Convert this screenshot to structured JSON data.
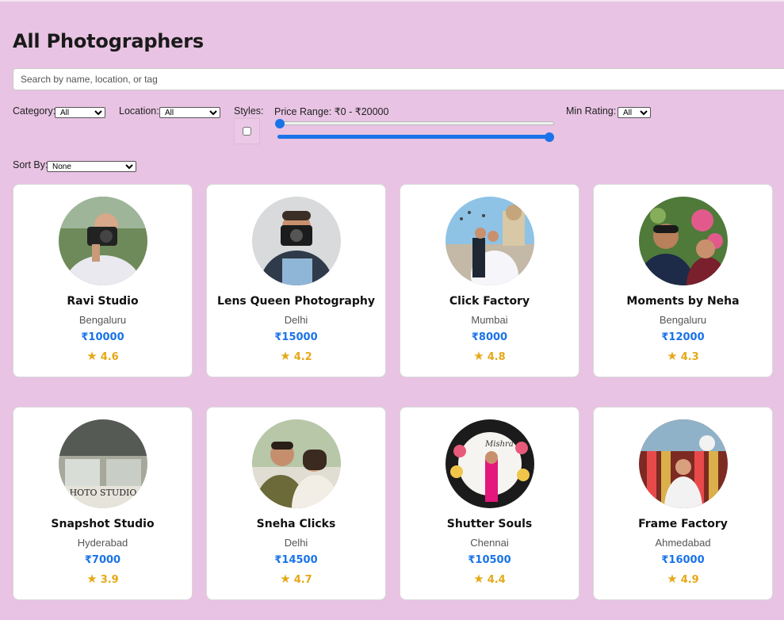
{
  "page": {
    "title": "All Photographers"
  },
  "search": {
    "placeholder": "Search by name, location, or tag",
    "value": ""
  },
  "filters": {
    "category_label": "Category:",
    "category_value": "All",
    "location_label": "Location:",
    "location_value": "All",
    "styles_label": "Styles:",
    "price_label": "Price Range: ₹0 - ₹20000",
    "price_min": 0,
    "price_max": 20000,
    "rating_label": "Min Rating:",
    "rating_value": "All",
    "sort_label": "Sort By:",
    "sort_value": "None"
  },
  "colors": {
    "background": "#e8c3e3",
    "accent": "#1a73e8",
    "price": "#1a73e8",
    "rating": "#e6a817"
  },
  "photographers": [
    {
      "name": "Ravi Studio",
      "city": "Bengaluru",
      "price": "₹10000",
      "rating": "4.6"
    },
    {
      "name": "Lens Queen Photography",
      "city": "Delhi",
      "price": "₹15000",
      "rating": "4.2"
    },
    {
      "name": "Click Factory",
      "city": "Mumbai",
      "price": "₹8000",
      "rating": "4.8"
    },
    {
      "name": "Moments by Neha",
      "city": "Bengaluru",
      "price": "₹12000",
      "rating": "4.3"
    },
    {
      "name": "Snapshot Studio",
      "city": "Hyderabad",
      "price": "₹7000",
      "rating": "3.9"
    },
    {
      "name": "Sneha Clicks",
      "city": "Delhi",
      "price": "₹14500",
      "rating": "4.7"
    },
    {
      "name": "Shutter Souls",
      "city": "Chennai",
      "price": "₹10500",
      "rating": "4.4"
    },
    {
      "name": "Frame Factory",
      "city": "Ahmedabad",
      "price": "₹16000",
      "rating": "4.9"
    }
  ],
  "star_icon": "star-icon"
}
